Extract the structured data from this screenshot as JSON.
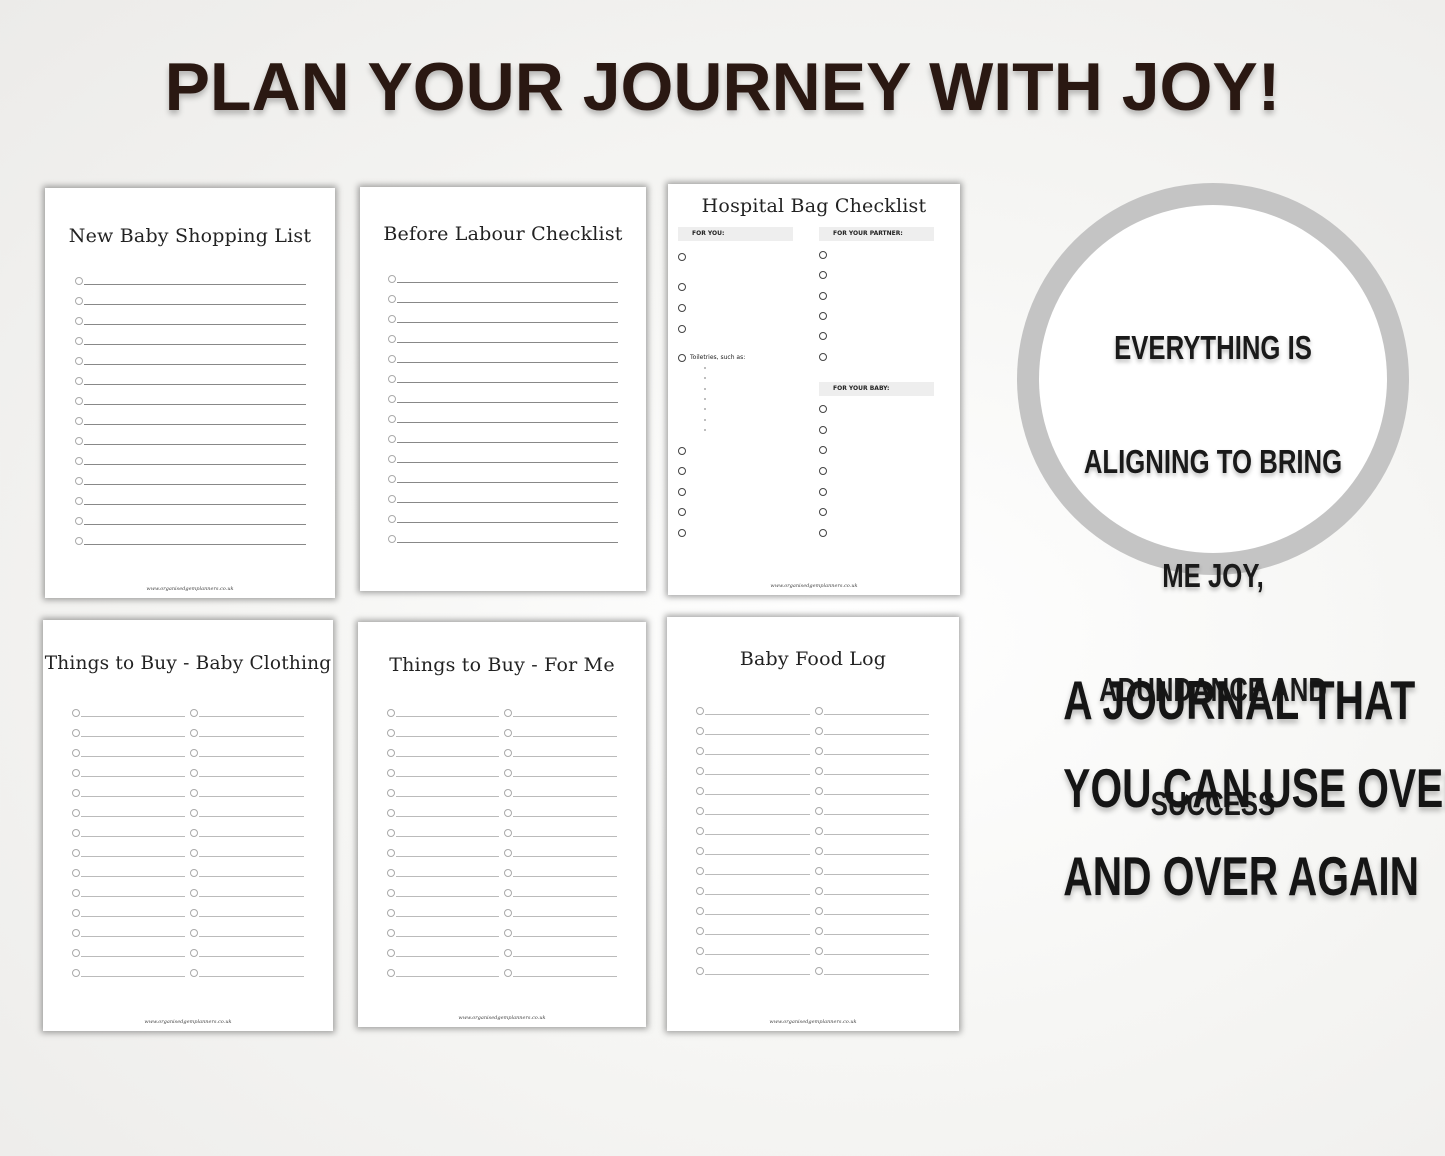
{
  "headline": "PLAN YOUR JOURNEY WITH JOY!",
  "pages": [
    {
      "title": "New Baby Shopping List",
      "layout": "single",
      "rows": 14,
      "footer": "www.organisedgemplanners.co.uk"
    },
    {
      "title": "Before Labour Checklist",
      "layout": "single",
      "rows": 14,
      "footer": ""
    },
    {
      "title": "Hospital Bag Checklist",
      "layout": "hospital",
      "footer": "www.organisedgemplanners.co.uk",
      "sections": {
        "for_you": "FOR YOU:",
        "for_partner": "FOR YOUR PARTNER:",
        "for_baby": "FOR YOUR BABY:"
      },
      "toiletries_label": "Toiletries, such as:"
    },
    {
      "title": "Things to Buy - Baby Clothing",
      "layout": "double",
      "rows": 14,
      "footer": "www.organisedgemplanners.co.uk"
    },
    {
      "title": "Things to Buy - For Me",
      "layout": "double",
      "rows": 14,
      "footer": "www.organisedgemplanners.co.uk"
    },
    {
      "title": "Baby Food Log",
      "layout": "double",
      "rows": 14,
      "footer": "www.organisedgemplanners.co.uk"
    }
  ],
  "affirmation": {
    "lines": [
      "EVERYTHING IS",
      "ALIGNING TO BRING",
      "ME JOY,",
      "ADUNDANCE AND",
      "SUCCESS"
    ]
  },
  "tagline": {
    "lines": [
      "A JOURNAL THAT",
      "YOU CAN USE OVER",
      "AND OVER AGAIN"
    ]
  }
}
